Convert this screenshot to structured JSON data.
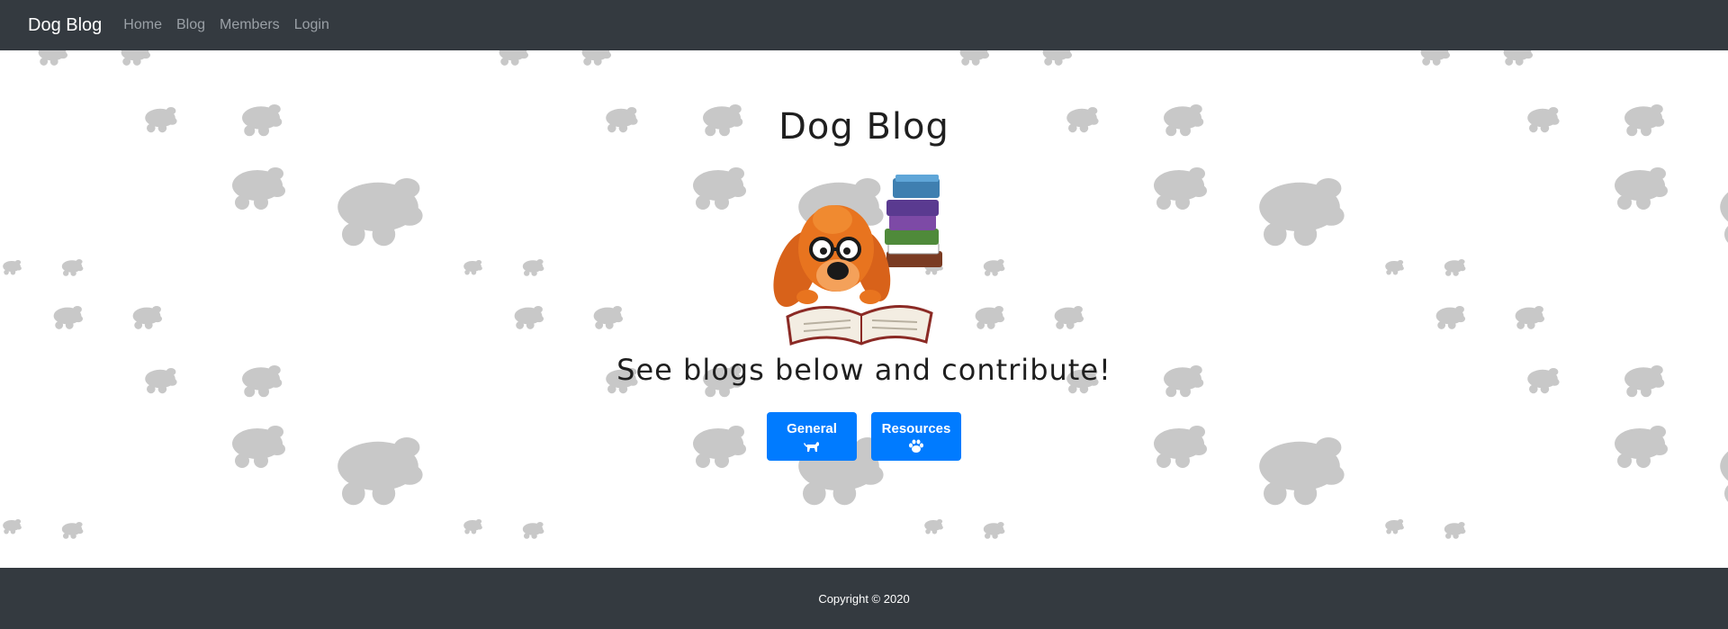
{
  "navbar": {
    "brand": "Dog Blog",
    "links": [
      "Home",
      "Blog",
      "Members",
      "Login"
    ]
  },
  "hero": {
    "title": "Dog Blog",
    "subtitle": "See blogs below and contribute!",
    "image_icon": "dog-reading-book-illustration"
  },
  "buttons": [
    {
      "label": "General",
      "icon": "dog-icon"
    },
    {
      "label": "Resources",
      "icon": "paw-icon"
    }
  ],
  "footer": {
    "copyright": "Copyright © 2020"
  },
  "colors": {
    "navbar_bg": "#343a40",
    "button_bg": "#007bff",
    "paw_color": "#c8c8c8",
    "nav_link": "#9aa0a6"
  }
}
